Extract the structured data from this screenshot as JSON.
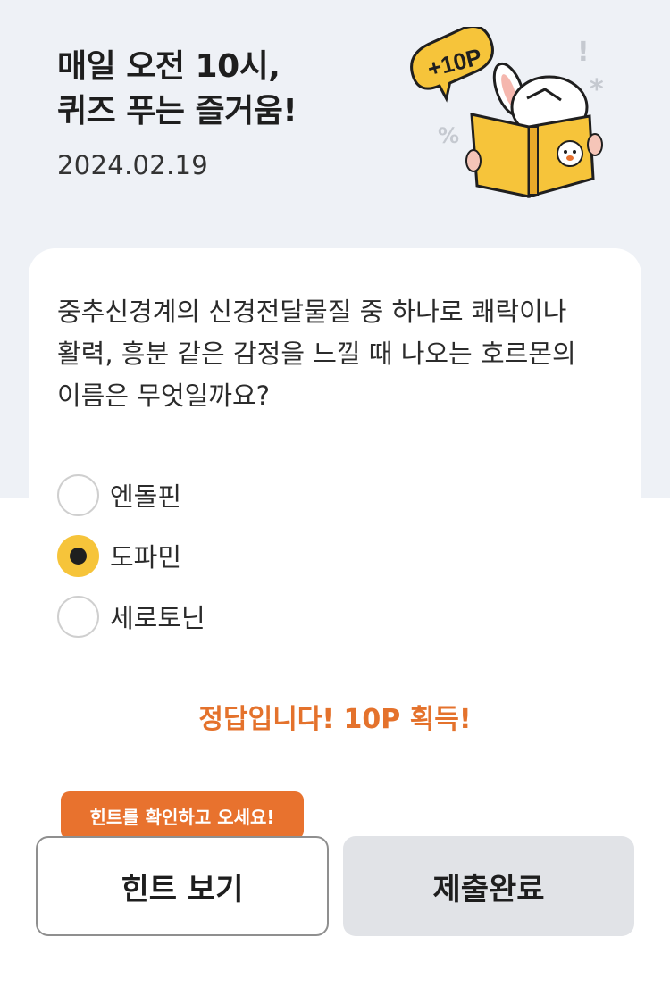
{
  "header": {
    "title_line1": "매일 오전 10시,",
    "title_line2": "퀴즈 푸는 즐거움!",
    "date": "2024.02.19",
    "badge": "+10P"
  },
  "quiz": {
    "question_lines": [
      "중추신경계의 신경전달물질 중 하나로 쾌락이나",
      "활력, 흥분 같은 감정을 느낄 때 나오는 호르몬의",
      "이름은 무엇일까요?"
    ],
    "options": [
      {
        "label": "엔돌핀",
        "selected": false
      },
      {
        "label": "도파민",
        "selected": true
      },
      {
        "label": "세로토닌",
        "selected": false
      }
    ],
    "result": "정답입니다! 10P 획득!"
  },
  "actions": {
    "tooltip": "힌트를 확인하고 오세요!",
    "hint_label": "힌트 보기",
    "submit_label": "제출완료"
  },
  "colors": {
    "background": "#eef1f6",
    "accent_yellow": "#f6c43a",
    "accent_orange": "#e8722e",
    "result_orange": "#e4722c",
    "submit_gray": "#e1e3e7"
  }
}
